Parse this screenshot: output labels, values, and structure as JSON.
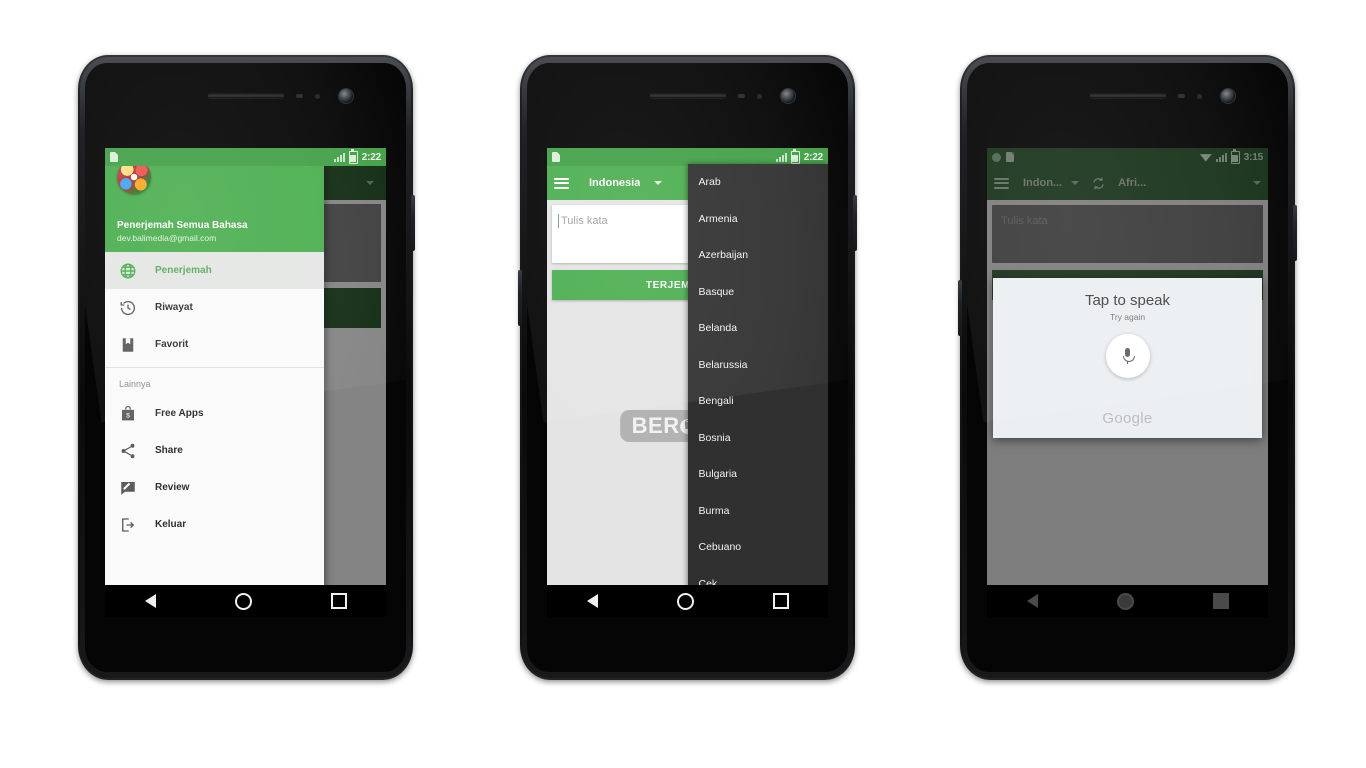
{
  "phones": [
    {
      "id": "phone-drawer",
      "statusbar": {
        "time": "2:22",
        "icons": [
          "sd-card-icon",
          "signal-icon",
          "battery-icon"
        ]
      },
      "drawer": {
        "account_name": "Penerjemah Semua Bahasa",
        "account_email": "dev.balimedia@gmail.com",
        "avatar_name": "app-globe-avatar",
        "items": [
          {
            "label": "Penerjemah",
            "icon": "globe-icon",
            "active": true
          },
          {
            "label": "Riwayat",
            "icon": "history-icon",
            "active": false
          },
          {
            "label": "Favorit",
            "icon": "bookmark-icon",
            "active": false
          }
        ],
        "section_label": "Lainnya",
        "more_items": [
          {
            "label": "Free Apps",
            "icon": "shop-bag-icon"
          },
          {
            "label": "Share",
            "icon": "share-icon"
          },
          {
            "label": "Review",
            "icon": "review-icon"
          },
          {
            "label": "Keluar",
            "icon": "exit-icon"
          }
        ]
      },
      "navbar": [
        "back-button",
        "home-button",
        "recents-button"
      ]
    },
    {
      "id": "phone-language-list",
      "statusbar": {
        "time": "2:22"
      },
      "toolbar": {
        "source_language": "Indonesia",
        "menu_icon": "hamburger-icon"
      },
      "input": {
        "placeholder": "Tulis kata",
        "value": ""
      },
      "translate_button": "TERJEMAHKAN",
      "language_menu": [
        "Arab",
        "Armenia",
        "Azerbaijan",
        "Basque",
        "Belanda",
        "Belarussia",
        "Bengali",
        "Bosnia",
        "Bulgaria",
        "Burma",
        "Cebuano",
        "Cek"
      ],
      "watermark": "BEROKAL",
      "navbar": [
        "back-button",
        "home-button",
        "recents-button"
      ]
    },
    {
      "id": "phone-voice-dialog",
      "statusbar": {
        "time": "3:15"
      },
      "toolbar": {
        "source_language": "Indon...",
        "target_language": "Afri...",
        "swap_icon": "swap-languages-icon",
        "menu_icon": "hamburger-icon"
      },
      "input": {
        "placeholder": "Tulis kata",
        "value": ""
      },
      "mic_icon": "microphone-icon",
      "voice_dialog": {
        "title": "Tap to speak",
        "subtitle": "Try again",
        "mic_button": "microphone-button",
        "brand": "Google"
      },
      "navbar": [
        "back-button",
        "home-button",
        "recents-button"
      ]
    }
  ],
  "colors": {
    "green": "#4caf50",
    "green_status": "#43a047",
    "dark_green": "#1f4d22",
    "menu_dark": "#303030",
    "content_grey": "#e4e4e4"
  }
}
